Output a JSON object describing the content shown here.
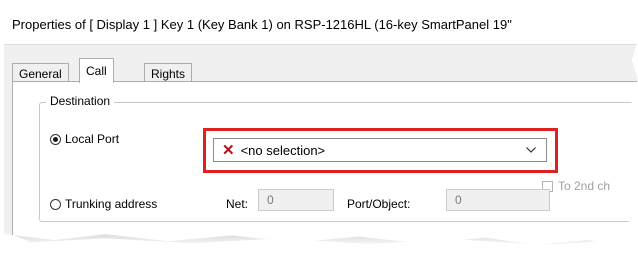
{
  "window": {
    "title": "Properties of [ Display 1 ] Key 1 (Key Bank 1) on RSP-1216HL (16-key SmartPanel 19\""
  },
  "tabs": [
    {
      "label": "General",
      "active": false
    },
    {
      "label": "Call",
      "active": true
    },
    {
      "label": "Rights",
      "active": false
    }
  ],
  "destination": {
    "legend": "Destination",
    "local_port": {
      "label": "Local Port",
      "checked": true,
      "combo": {
        "value": "<no selection>",
        "icon": "x-icon"
      }
    },
    "to_2nd": {
      "label": "To 2nd ch",
      "checked": false
    },
    "trunking": {
      "label": "Trunking address",
      "checked": false,
      "net_label": "Net:",
      "net_value": "0",
      "port_object_label": "Port/Object:",
      "port_object_value": "0"
    }
  },
  "colors": {
    "highlight": "#e02020",
    "x_icon": "#a81818",
    "panel_bg": "#ffffff",
    "dialog_bg": "#f0f0f0"
  }
}
